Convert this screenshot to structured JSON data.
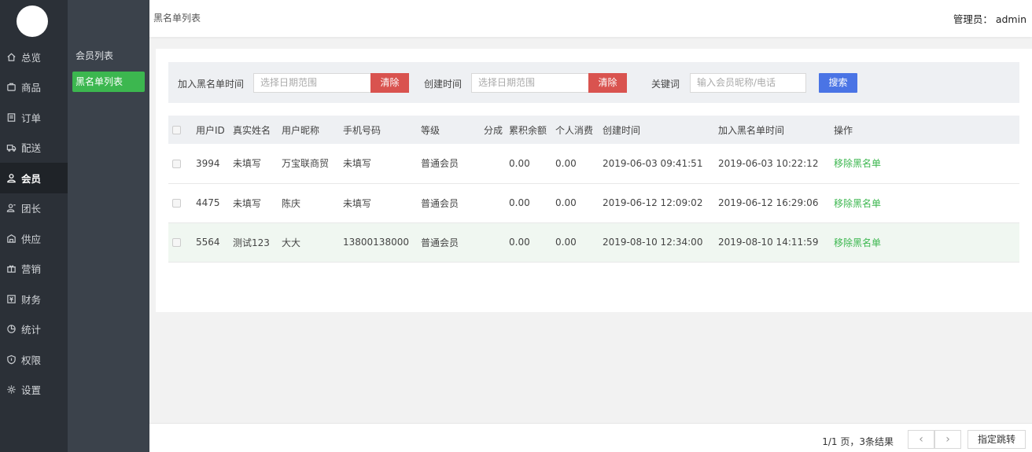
{
  "sidebar": {
    "items": [
      {
        "label": "总览",
        "icon": "home-icon"
      },
      {
        "label": "商品",
        "icon": "goods-icon"
      },
      {
        "label": "订单",
        "icon": "order-icon"
      },
      {
        "label": "配送",
        "icon": "delivery-icon"
      },
      {
        "label": "会员",
        "icon": "user-icon",
        "active": true
      },
      {
        "label": "团长",
        "icon": "leader-icon"
      },
      {
        "label": "供应",
        "icon": "supply-icon"
      },
      {
        "label": "营销",
        "icon": "gift-icon"
      },
      {
        "label": "财务",
        "icon": "finance-icon"
      },
      {
        "label": "统计",
        "icon": "chart-icon"
      },
      {
        "label": "权限",
        "icon": "shield-icon"
      },
      {
        "label": "设置",
        "icon": "gear-icon"
      }
    ]
  },
  "subnav": {
    "items": [
      {
        "label": "会员列表"
      },
      {
        "label": "黑名单列表",
        "active": true
      }
    ]
  },
  "header": {
    "breadcrumb": "黑名单列表",
    "admin_label": "管理员：",
    "admin_name": "admin"
  },
  "filter": {
    "blacklist_time_label": "加入黑名单时间",
    "blacklist_time_placeholder": "选择日期范围",
    "clear1": "清除",
    "create_time_label": "创建时间",
    "create_time_placeholder": "选择日期范围",
    "clear2": "清除",
    "keyword_label": "关键词",
    "keyword_placeholder": "输入会员昵称/电话",
    "search": "搜索"
  },
  "table": {
    "headers": [
      "用户ID",
      "真实姓名",
      "用户昵称",
      "手机号码",
      "等级",
      "分成",
      "累积余额",
      "个人消费",
      "创建时间",
      "加入黑名单时间",
      "操作"
    ],
    "rows": [
      {
        "id": "3994",
        "real_name": "未填写",
        "nickname": "万宝联商贸",
        "phone": "未填写",
        "level": "普通会员",
        "share": "",
        "balance": "0.00",
        "consume": "0.00",
        "created": "2019-06-03 09:41:51",
        "blacklisted": "2019-06-03 10:22:12",
        "action": "移除黑名单"
      },
      {
        "id": "4475",
        "real_name": "未填写",
        "nickname": "陈庆",
        "phone": "未填写",
        "level": "普通会员",
        "share": "",
        "balance": "0.00",
        "consume": "0.00",
        "created": "2019-06-12 12:09:02",
        "blacklisted": "2019-06-12 16:29:06",
        "action": "移除黑名单"
      },
      {
        "id": "5564",
        "real_name": "测试123",
        "nickname": "大大",
        "phone": "13800138000",
        "level": "普通会员",
        "share": "",
        "balance": "0.00",
        "consume": "0.00",
        "created": "2019-08-10 12:34:00",
        "blacklisted": "2019-08-10 14:11:59",
        "action": "移除黑名单"
      }
    ]
  },
  "pagination": {
    "info": "1/1 页，3条结果",
    "prev": "‹",
    "next": "›",
    "jump": "指定跳转"
  },
  "colors": {
    "accent_green": "#3cb74f",
    "danger_red": "#d9534f",
    "primary_blue": "#4a74e5",
    "sidebar_dark": "#2b3037"
  }
}
